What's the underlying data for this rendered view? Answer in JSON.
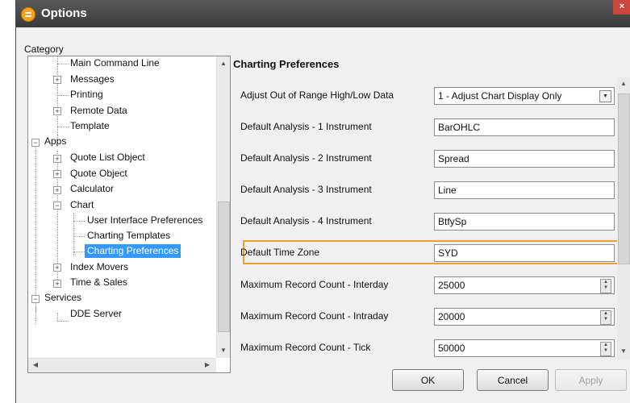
{
  "window": {
    "title": "Options",
    "close_icon": "×"
  },
  "category_label": "Category",
  "tree": {
    "items": [
      {
        "label": "Main Command Line"
      },
      {
        "label": "Messages"
      },
      {
        "label": "Printing"
      },
      {
        "label": "Remote Data"
      },
      {
        "label": "Template"
      },
      {
        "label": "Apps"
      },
      {
        "label": "Quote List Object"
      },
      {
        "label": "Quote Object"
      },
      {
        "label": "Calculator"
      },
      {
        "label": "Chart"
      },
      {
        "label": "User Interface Preferences"
      },
      {
        "label": "Charting Templates"
      },
      {
        "label": "Charting Preferences",
        "selected": true
      },
      {
        "label": "Index Movers"
      },
      {
        "label": "Time & Sales"
      },
      {
        "label": "Services"
      },
      {
        "label": "DDE Server"
      }
    ]
  },
  "preferences": {
    "title": "Charting Preferences",
    "rows": [
      {
        "label": "Adjust Out of Range High/Low Data",
        "value": "1 - Adjust Chart Display Only",
        "type": "select"
      },
      {
        "label": "Default Analysis - 1 Instrument",
        "value": "BarOHLC",
        "type": "text"
      },
      {
        "label": "Default Analysis - 2 Instrument",
        "value": "Spread",
        "type": "text"
      },
      {
        "label": "Default Analysis - 3 Instrument",
        "value": "Line",
        "type": "text"
      },
      {
        "label": "Default Analysis - 4 Instrument",
        "value": "BtfySp",
        "type": "text"
      },
      {
        "label": "Default Time Zone",
        "value": "SYD",
        "type": "text",
        "highlighted": true
      },
      {
        "label": "Maximum Record Count - Interday",
        "value": "25000",
        "type": "number"
      },
      {
        "label": "Maximum Record Count - Intraday",
        "value": "20000",
        "type": "number"
      },
      {
        "label": "Maximum Record Count - Tick",
        "value": "50000",
        "type": "number"
      }
    ]
  },
  "buttons": {
    "ok": "OK",
    "cancel": "Cancel",
    "apply": "Apply"
  },
  "colors": {
    "titlebar": "#3f3f3f",
    "selection": "#3399ff",
    "highlight": "#f0a02a"
  }
}
